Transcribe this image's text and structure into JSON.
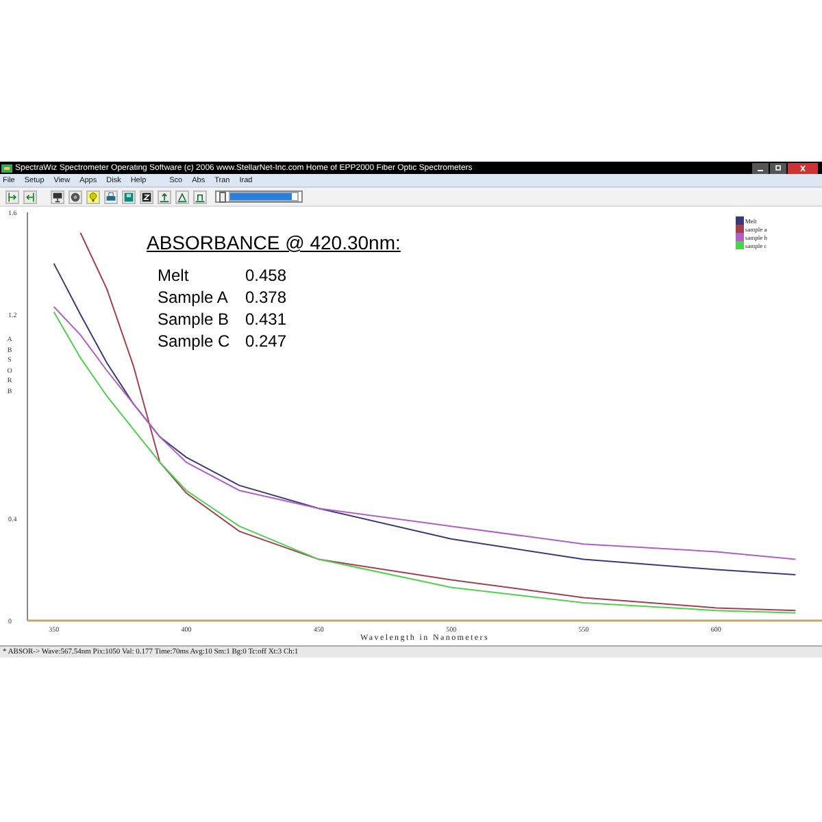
{
  "window": {
    "title": "SpectraWiz  Spectrometer Operating Software (c) 2006  www.StellarNet-Inc.com  Home of EPP2000 Fiber Optic Spectrometers"
  },
  "menu": [
    "File",
    "Setup",
    "View",
    "Apps",
    "Disk",
    "Help",
    "Sco",
    "Abs",
    "Tran",
    "Irad"
  ],
  "toolbar": {
    "progress": {
      "level": 0.92
    }
  },
  "readout": {
    "title": "ABSORBANCE @ 420.30nm:",
    "rows": [
      {
        "label": "Melt",
        "value": "0.458"
      },
      {
        "label": "Sample A",
        "value": "0.378"
      },
      {
        "label": "Sample B",
        "value": "0.431"
      },
      {
        "label": "Sample C",
        "value": "0.247"
      }
    ]
  },
  "chart_data": {
    "type": "line",
    "legend": "top-right",
    "xlabel": "Wavelength in Nanometers",
    "ylabel": "ABSORB",
    "x": [
      350,
      360,
      370,
      380,
      390,
      400,
      420,
      450,
      500,
      550,
      600,
      630
    ],
    "xlim": [
      340,
      640
    ],
    "ylim": [
      0,
      1.6
    ],
    "xticks": [
      350,
      400,
      450,
      500,
      550,
      600
    ],
    "yticks": [
      0,
      0.4,
      1.2,
      1.6
    ],
    "series": [
      {
        "name": "Melt",
        "color": "#3a3a7a",
        "values": [
          1.4,
          1.2,
          1.01,
          0.85,
          0.72,
          0.64,
          0.53,
          0.44,
          0.32,
          0.24,
          0.2,
          0.18
        ]
      },
      {
        "name": "sample a",
        "color": "#a04050",
        "values": [
          null,
          1.52,
          1.3,
          1.0,
          0.62,
          0.5,
          0.35,
          0.24,
          0.16,
          0.09,
          0.05,
          0.04
        ]
      },
      {
        "name": "sample b",
        "color": "#b060c0",
        "values": [
          1.23,
          1.12,
          0.98,
          0.85,
          0.72,
          0.62,
          0.51,
          0.44,
          0.37,
          0.3,
          0.27,
          0.24
        ]
      },
      {
        "name": "sample c",
        "color": "#50d050",
        "values": [
          1.21,
          1.03,
          0.88,
          0.75,
          0.62,
          0.51,
          0.37,
          0.24,
          0.13,
          0.07,
          0.04,
          0.03
        ]
      }
    ]
  },
  "status_bar": {
    "text": "* ABSOR->  Wave:567.54nm  Pix:1050  Val:  0.177  Time:70ms  Avg:10  Sm:1  Bg:0  Tc:off  Xt:3  Ch:1"
  }
}
